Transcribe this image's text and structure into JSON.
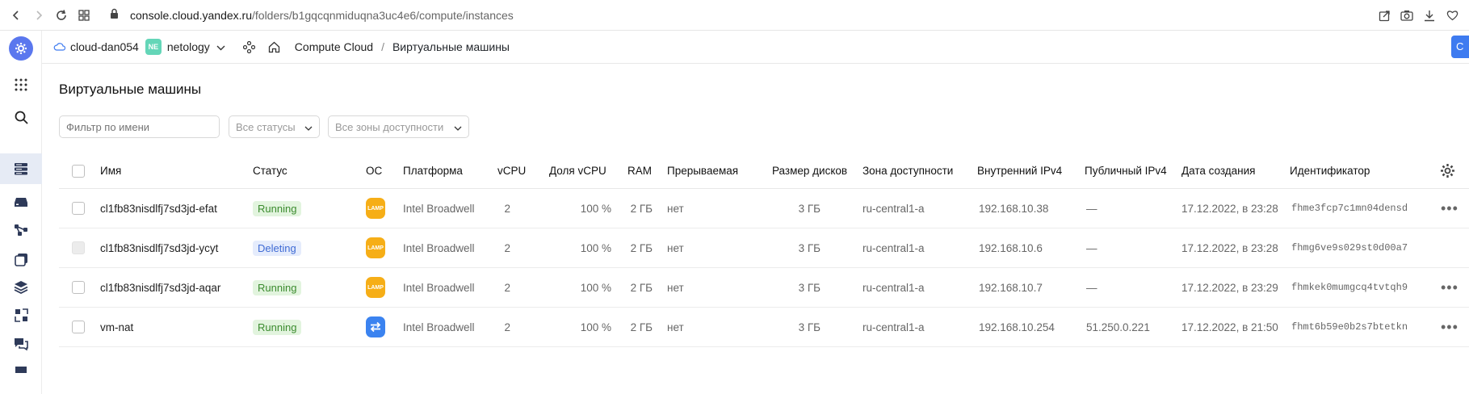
{
  "browser": {
    "url_domain": "console.cloud.yandex.ru",
    "url_path": "/folders/b1gqcqnmiduqna3uc4e6/compute/instances"
  },
  "header": {
    "cloud_name": "cloud-dan054",
    "folder_badge": "NE",
    "folder_name": "netology",
    "service": "Compute Cloud",
    "separator": "/",
    "current_page": "Виртуальные машины",
    "cta_label": "С"
  },
  "page": {
    "title": "Виртуальные машины",
    "filter_placeholder": "Фильтр по имени",
    "status_filter": "Все статусы",
    "zone_filter": "Все зоны доступности"
  },
  "table": {
    "columns": {
      "name": "Имя",
      "status": "Статус",
      "os": "ОС",
      "platform": "Платформа",
      "vcpu": "vCPU",
      "vcpu_share": "Доля vCPU",
      "ram": "RAM",
      "preemptible": "Прерываемая",
      "disk_size": "Размер дисков",
      "zone": "Зона доступности",
      "internal_ip": "Внутренний IPv4",
      "public_ip": "Публичный IPv4",
      "created": "Дата создания",
      "id": "Идентификатор"
    },
    "rows": [
      {
        "name": "cl1fb83nisdlfj7sd3jd-efat",
        "status": "Running",
        "os": "LAMP",
        "platform": "Intel Broadwell",
        "vcpu": "2",
        "vcpu_share": "100 %",
        "ram": "2 ГБ",
        "preemptible": "нет",
        "disk_size": "3 ГБ",
        "zone": "ru-central1-a",
        "internal_ip": "192.168.10.38",
        "public_ip": "—",
        "created": "17.12.2022, в 23:28",
        "id": "fhme3fcp7c1mn04densd",
        "menu": "•••"
      },
      {
        "name": "cl1fb83nisdlfj7sd3jd-ycyt",
        "status": "Deleting",
        "os": "LAMP",
        "platform": "Intel Broadwell",
        "vcpu": "2",
        "vcpu_share": "100 %",
        "ram": "2 ГБ",
        "preemptible": "нет",
        "disk_size": "3 ГБ",
        "zone": "ru-central1-a",
        "internal_ip": "192.168.10.6",
        "public_ip": "—",
        "created": "17.12.2022, в 23:28",
        "id": "fhmg6ve9s029st0d00a7",
        "menu": ""
      },
      {
        "name": "cl1fb83nisdlfj7sd3jd-aqar",
        "status": "Running",
        "os": "LAMP",
        "platform": "Intel Broadwell",
        "vcpu": "2",
        "vcpu_share": "100 %",
        "ram": "2 ГБ",
        "preemptible": "нет",
        "disk_size": "3 ГБ",
        "zone": "ru-central1-a",
        "internal_ip": "192.168.10.7",
        "public_ip": "—",
        "created": "17.12.2022, в 23:29",
        "id": "fhmkek0mumgcq4tvtqh9",
        "menu": "•••"
      },
      {
        "name": "vm-nat",
        "status": "Running",
        "os": "NAT",
        "platform": "Intel Broadwell",
        "vcpu": "2",
        "vcpu_share": "100 %",
        "ram": "2 ГБ",
        "preemptible": "нет",
        "disk_size": "3 ГБ",
        "zone": "ru-central1-a",
        "internal_ip": "192.168.10.254",
        "public_ip": "51.250.0.221",
        "created": "17.12.2022, в 21:50",
        "id": "fhmt6b59e0b2s7btetkn",
        "menu": "•••"
      }
    ]
  },
  "colors": {
    "accent": "#3e7bf0",
    "running_bg": "#e2f4de",
    "running_text": "#3b8b2e",
    "deleting_bg": "#e5ecfc",
    "deleting_text": "#3f6bd4",
    "lamp": "#f6ae17"
  },
  "icons": [
    "back-icon",
    "forward-icon",
    "reload-icon",
    "tabs-grid-icon",
    "lock-icon",
    "share-icon",
    "camera-icon",
    "download-icon",
    "heart-icon",
    "settings-logo-icon",
    "apps-grid-icon",
    "search-icon",
    "compute-icon",
    "storage-icon",
    "network-icon",
    "images-icon",
    "layers-icon",
    "snapshot-icon",
    "chat-icon",
    "cloud-icon",
    "chevron-down-icon",
    "services-icon",
    "home-icon",
    "table-settings-gear-icon"
  ]
}
